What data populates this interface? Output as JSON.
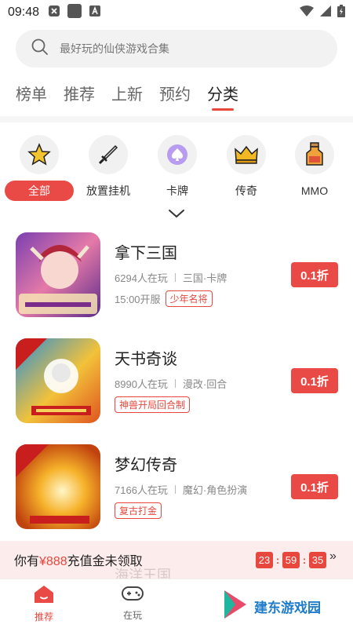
{
  "status_bar": {
    "time": "09:48"
  },
  "search": {
    "placeholder": "最好玩的仙侠游戏合集"
  },
  "tabs": [
    {
      "label": "榜单"
    },
    {
      "label": "推荐"
    },
    {
      "label": "上新"
    },
    {
      "label": "预约"
    },
    {
      "label": "分类",
      "active": true
    }
  ],
  "categories": [
    {
      "label": "全部",
      "icon": "star-icon",
      "active": true
    },
    {
      "label": "放置挂机",
      "icon": "sword-icon"
    },
    {
      "label": "卡牌",
      "icon": "spade-icon"
    },
    {
      "label": "传奇",
      "icon": "crown-icon"
    },
    {
      "label": "MMO",
      "icon": "potion-icon"
    }
  ],
  "games": [
    {
      "title": "拿下三国",
      "players": "6294人在玩",
      "genre": "三国·卡牌",
      "open_time": "15:00开服",
      "tag": "少年名将",
      "discount": "0.1折"
    },
    {
      "title": "天书奇谈",
      "players": "8990人在玩",
      "genre": "漫改·回合",
      "open_time": "",
      "tag": "神兽开局回合制",
      "discount": "0.1折"
    },
    {
      "title": "梦幻传奇",
      "players": "7166人在玩",
      "genre": "魔幻·角色扮演",
      "open_time": "",
      "tag": "复古打金",
      "discount": "0.1折"
    }
  ],
  "promo": {
    "prefix": "你有",
    "amount": "¥888",
    "suffix": "充值金未领取",
    "countdown": {
      "h": "23",
      "m": "59",
      "s": "35"
    },
    "arrow": "»",
    "behind_text": "海洋王国"
  },
  "bottom_nav": [
    {
      "label": "推荐",
      "active": true
    },
    {
      "label": "在玩"
    }
  ],
  "watermark": {
    "text": "建东游戏园"
  },
  "colors": {
    "accent": "#ea4a45",
    "tag_red": "#e8473e",
    "search_bg": "#f2f2f2"
  }
}
